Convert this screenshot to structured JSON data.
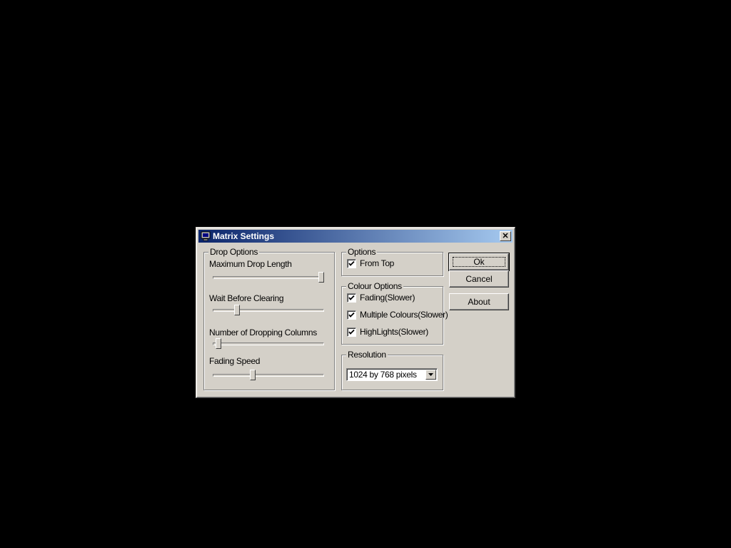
{
  "dialog": {
    "title": "Matrix Settings",
    "close_glyph": "✕"
  },
  "drop_options": {
    "group_label": "Drop Options",
    "sliders": [
      {
        "label": "Maximum Drop Length",
        "level": 1.0
      },
      {
        "label": "Wait Before Clearing",
        "level": 0.2
      },
      {
        "label": "Number of Dropping Columns",
        "level": 0.03
      },
      {
        "label": "Fading Speed",
        "level": 0.35
      }
    ]
  },
  "options": {
    "group_label": "Options",
    "items": [
      {
        "label": "From Top",
        "checked": true
      }
    ]
  },
  "colour_options": {
    "group_label": "Colour Options",
    "items": [
      {
        "label": "Fading(Slower)",
        "checked": true
      },
      {
        "label": "Multiple Colours(Slower)",
        "checked": true
      },
      {
        "label": "HighLights(Slower)",
        "checked": true
      }
    ]
  },
  "resolution": {
    "group_label": "Resolution",
    "selected": "1024 by 768 pixels"
  },
  "buttons": {
    "ok": "Ok",
    "cancel": "Cancel",
    "about": "About"
  },
  "icons": {
    "app": "monitor-icon",
    "close": "close-icon",
    "dropdown": "dropdown-arrow-icon",
    "check": "checkmark-icon"
  }
}
